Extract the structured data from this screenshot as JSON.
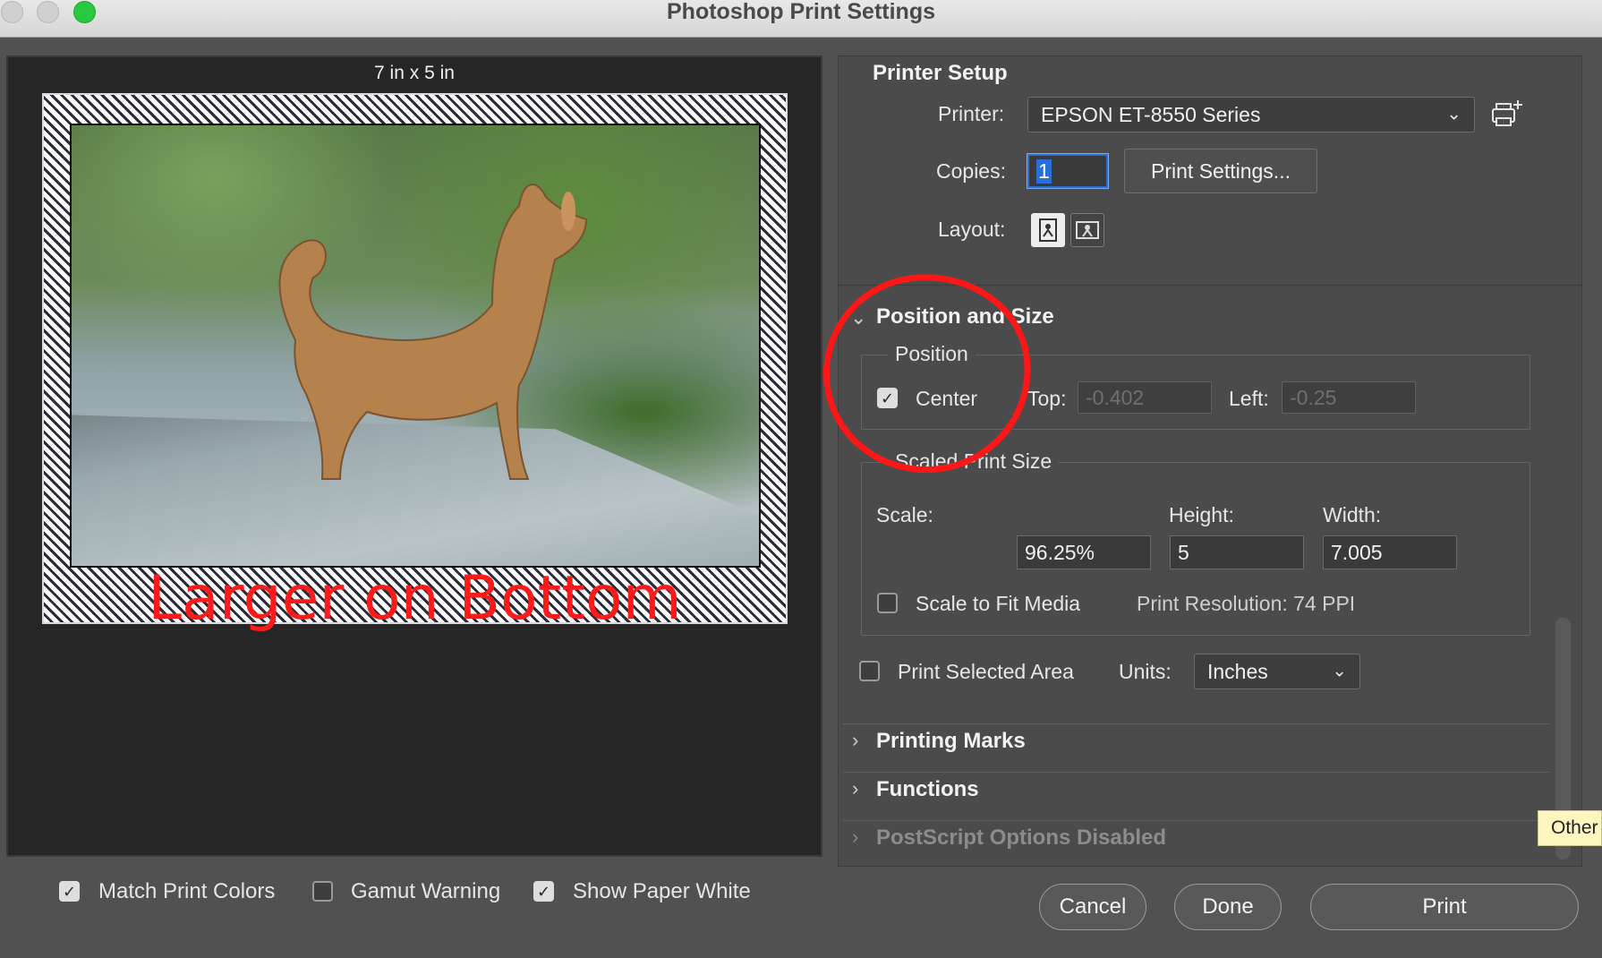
{
  "window": {
    "title": "Photoshop Print Settings"
  },
  "preview": {
    "size_label": "7 in x 5 in",
    "caption": "Larger on Bottom"
  },
  "printer_setup": {
    "title": "Printer Setup",
    "printer_label": "Printer:",
    "printer_value": "EPSON ET-8550 Series",
    "copies_label": "Copies:",
    "copies_value": "1",
    "print_settings_button": "Print Settings...",
    "layout_label": "Layout:"
  },
  "position_and_size": {
    "title": "Position and Size",
    "position_group": "Position",
    "center_label": "Center",
    "center_checked": true,
    "top_label": "Top:",
    "top_value": "-0.402",
    "left_label": "Left:",
    "left_value": "-0.25",
    "scaled_group": "Scaled Print Size",
    "scale_label": "Scale:",
    "height_label": "Height:",
    "width_label": "Width:",
    "scale_value": "96.25%",
    "height_value": "5",
    "width_value": "7.005",
    "scale_to_fit_label": "Scale to Fit Media",
    "print_resolution": "Print Resolution: 74 PPI",
    "print_selected_area_label": "Print Selected Area",
    "units_label": "Units:",
    "units_value": "Inches"
  },
  "sections": {
    "printing_marks": "Printing Marks",
    "functions": "Functions",
    "postscript": "PostScript Options Disabled"
  },
  "tooltip": "Other",
  "bottom": {
    "match_print_colors": "Match Print Colors",
    "gamut_warning": "Gamut Warning",
    "show_paper_white": "Show Paper White",
    "cancel": "Cancel",
    "done": "Done",
    "print": "Print"
  },
  "colors": {
    "accent": "#2a6ed8",
    "annotation": "#ff1616",
    "panel": "#4b4b4b"
  }
}
